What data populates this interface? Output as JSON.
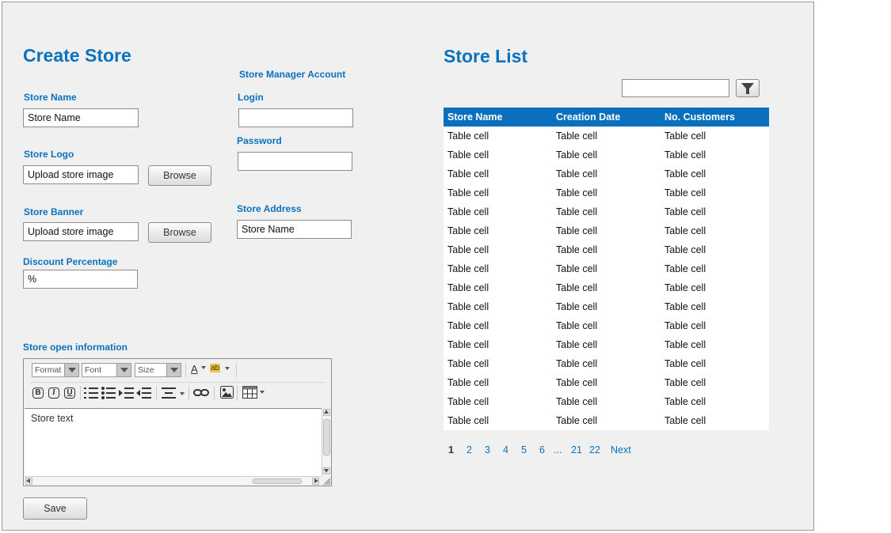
{
  "create": {
    "title": "Create Store",
    "store_name_label": "Store Name",
    "store_name_value": "Store Name",
    "store_logo_label": "Store Logo",
    "store_logo_value": "Upload store image",
    "browse_label": "Browse",
    "store_banner_label": "Store Banner",
    "store_banner_value": "Upload store image",
    "discount_label": "Discount Percentage",
    "discount_value": "%",
    "manager_heading": "Store Manager Account",
    "login_label": "Login",
    "login_value": "",
    "password_label": "Password",
    "password_value": "",
    "address_label": "Store Address",
    "address_value": "Store Name",
    "open_info_label": "Store open information",
    "save_label": "Save"
  },
  "editor": {
    "format_select": "Format",
    "font_select": "Font",
    "size_select": "Size",
    "text_color_glyph": "A",
    "highlight_glyph": "ab",
    "bold_glyph": "B",
    "italic_glyph": "I",
    "underline_glyph": "U",
    "content": "Store text"
  },
  "list": {
    "title": "Store List",
    "filter_value": "",
    "columns": [
      "Store Name",
      "Creation Date",
      "No. Customers"
    ],
    "rows": [
      [
        "Table cell",
        "Table cell",
        "Table cell"
      ],
      [
        "Table cell",
        "Table cell",
        "Table cell"
      ],
      [
        "Table cell",
        "Table cell",
        "Table cell"
      ],
      [
        "Table cell",
        "Table cell",
        "Table cell"
      ],
      [
        "Table cell",
        "Table cell",
        "Table cell"
      ],
      [
        "Table cell",
        "Table cell",
        "Table cell"
      ],
      [
        "Table cell",
        "Table cell",
        "Table cell"
      ],
      [
        "Table cell",
        "Table cell",
        "Table cell"
      ],
      [
        "Table cell",
        "Table cell",
        "Table cell"
      ],
      [
        "Table cell",
        "Table cell",
        "Table cell"
      ],
      [
        "Table cell",
        "Table cell",
        "Table cell"
      ],
      [
        "Table cell",
        "Table cell",
        "Table cell"
      ],
      [
        "Table cell",
        "Table cell",
        "Table cell"
      ],
      [
        "Table cell",
        "Table cell",
        "Table cell"
      ],
      [
        "Table cell",
        "Table cell",
        "Table cell"
      ],
      [
        "Table cell",
        "Table cell",
        "Table cell"
      ]
    ],
    "pagination": {
      "current": "1",
      "pages": [
        "2",
        "3",
        "4",
        "5",
        "6",
        "...",
        "21",
        "22"
      ],
      "next": "Next"
    }
  },
  "icons": {
    "filter": "filter-icon",
    "link": "link-icon",
    "image": "image-icon",
    "table": "table-icon"
  },
  "colors": {
    "accent": "#0a72bd",
    "table_header": "#0a6fbd",
    "background": "#f0f0f0"
  }
}
